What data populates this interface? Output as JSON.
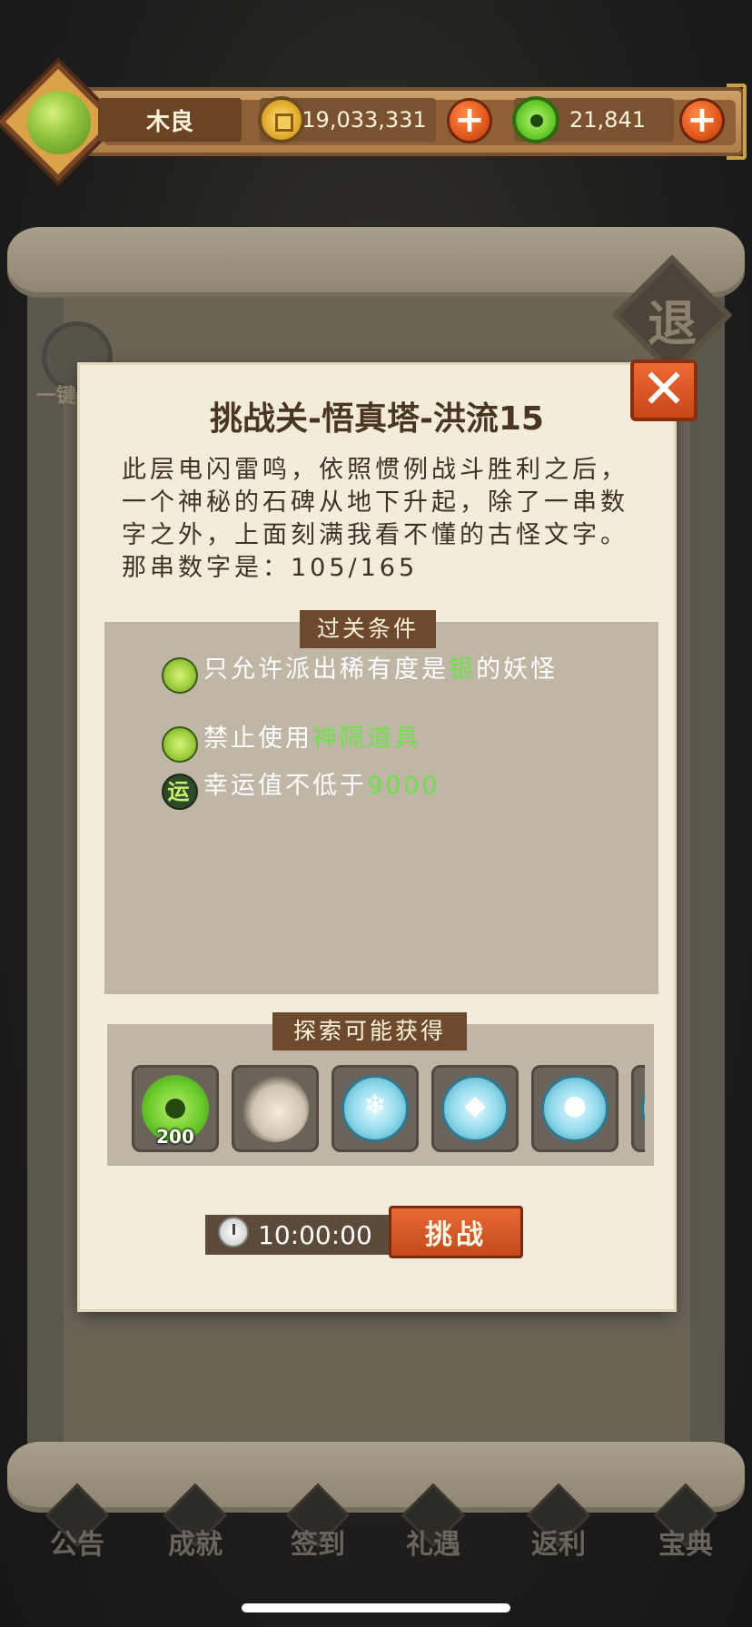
{
  "player": {
    "name": "木良",
    "coins": "19,033,331",
    "jade": "21,841"
  },
  "background": {
    "exit_label": "退",
    "compass_label": "一键",
    "nav_items": [
      "公告",
      "成就",
      "签到",
      "礼遇",
      "返利",
      "宝典"
    ]
  },
  "dialog": {
    "title": "挑战关-悟真塔-洪流15",
    "description": "此层电闪雷鸣，依照惯例战斗胜利之后，一个神秘的石碑从地下升起，除了一串数字之外，上面刻满我看不懂的古怪文字。那串数字是：105/165",
    "conditions_title": "过关条件",
    "conditions": [
      {
        "icon": "green-orb-icon",
        "text_before": "只允许派出稀有度是",
        "highlight": "银",
        "text_after": "的妖怪"
      },
      {
        "icon": "green-orb-icon",
        "text_before": "禁止使用",
        "highlight": "神隔道具",
        "text_after": ""
      },
      {
        "icon": "luck-icon",
        "icon_glyph": "运",
        "text_before": "幸运值不低于",
        "highlight": "9000",
        "text_after": ""
      }
    ],
    "rewards_title": "探索可能获得",
    "rewards": [
      {
        "type": "jade-orb",
        "qty": "200"
      },
      {
        "type": "creature",
        "qty": ""
      },
      {
        "type": "ice-crystal",
        "qty": ""
      },
      {
        "type": "ice-shard",
        "qty": ""
      },
      {
        "type": "ice-orb",
        "qty": ""
      }
    ],
    "timer": "10:00:00",
    "challenge_label": "挑战"
  },
  "colors": {
    "highlight": "#6fe04a",
    "button": "#d9582a",
    "panel": "#f3ecdb"
  }
}
